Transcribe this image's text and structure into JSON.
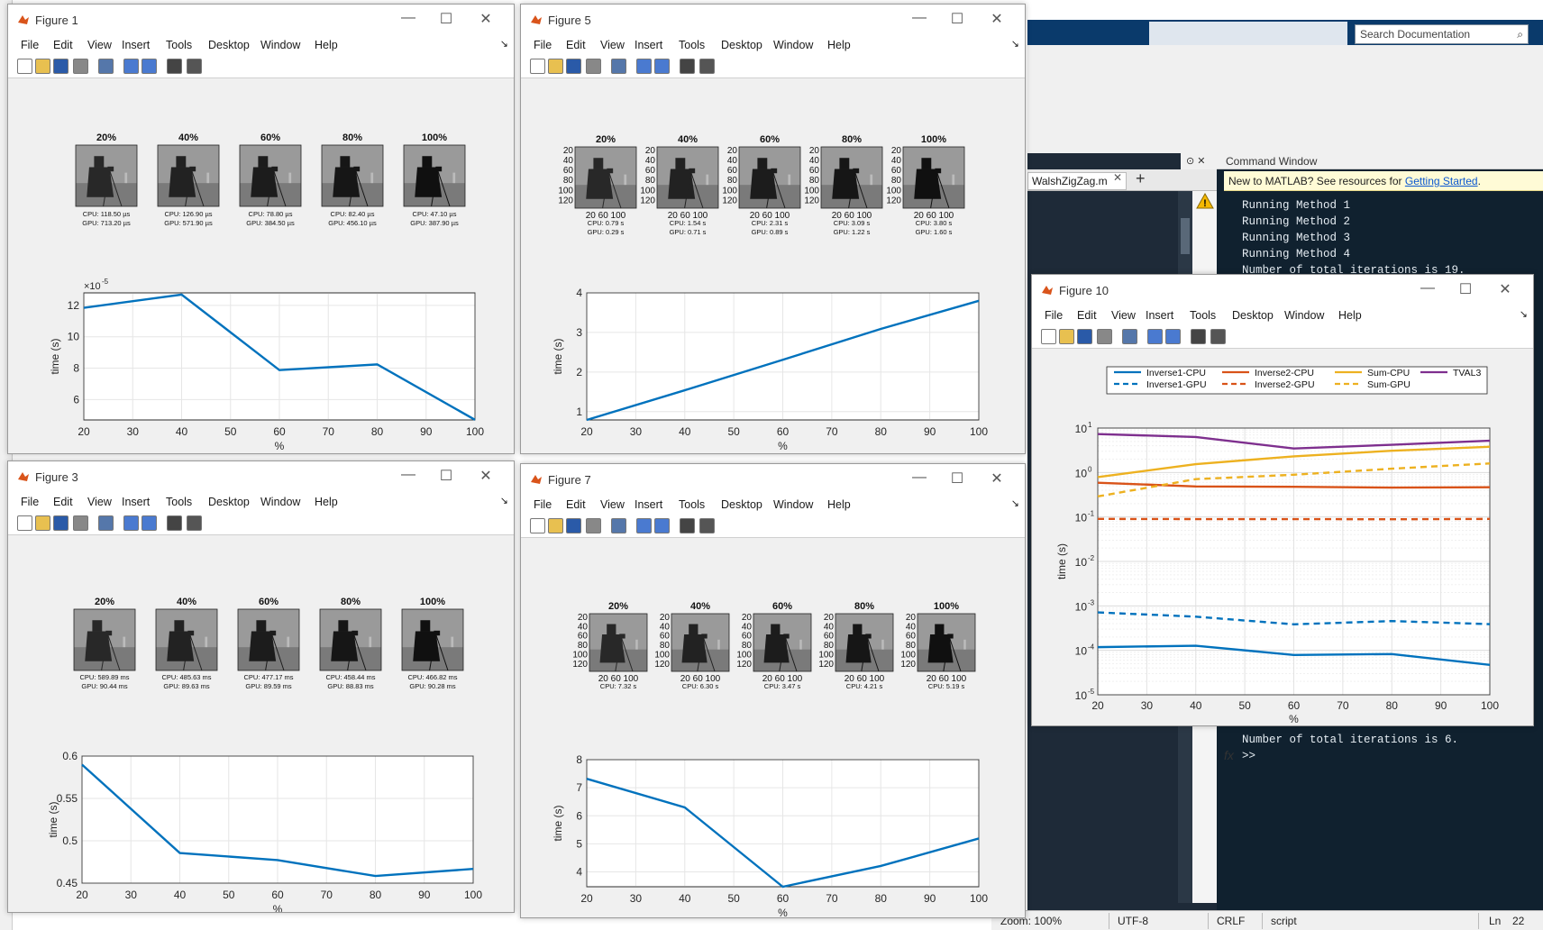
{
  "desktop": {
    "search_placeholder": "Search Documentation",
    "editor_tab": "WalshZigZag.m",
    "command_window_title": "Command Window",
    "new_to_matlab": "New to MATLAB? See resources for ",
    "getting_started": "Getting Started",
    "cmd_lines_top": [
      "Running Method 1",
      "Running Method 2",
      "Running Method 3",
      "Running Method 4",
      "Number of total iterations is 19."
    ],
    "cmd_lines_bottom": [
      "Number of total iterations is 6.",
      ">>"
    ],
    "status": {
      "zoom": "Zoom: 100%",
      "encoding": "UTF-8",
      "eol": "CRLF",
      "mode": "script",
      "ln": "Ln",
      "ln_value": "22"
    }
  },
  "menu_items": [
    "File",
    "Edit",
    "View",
    "Insert",
    "Tools",
    "Desktop",
    "Window",
    "Help"
  ],
  "win_controls": {
    "minimize": "—",
    "maximize": "☐",
    "close": "✕"
  },
  "figures": {
    "fig1": {
      "title": "Figure 1",
      "pct": [
        "20%",
        "40%",
        "60%",
        "80%",
        "100%"
      ],
      "cap1": [
        "CPU: 118.50 µs",
        "CPU: 126.90 µs",
        "CPU: 78.80 µs",
        "CPU: 82.40 µs",
        "CPU: 47.10 µs"
      ],
      "cap2": [
        "GPU: 713.20 µs",
        "GPU: 571.90 µs",
        "GPU: 384.50 µs",
        "GPU: 456.10 µs",
        "GPU: 387.90 µs"
      ],
      "chart_data": {
        "type": "line",
        "x": [
          20,
          40,
          60,
          80,
          100
        ],
        "values": [
          11.85,
          12.69,
          7.88,
          8.24,
          4.71
        ],
        "ylabel": "time (s)",
        "xlabel": "%",
        "exponent": "×10",
        "exponent_power": "-5",
        "xlim": [
          20,
          100
        ],
        "ylim": [
          4.7,
          12.8
        ],
        "yticks": [
          6,
          8,
          10,
          12
        ],
        "xticks": [
          20,
          30,
          40,
          50,
          60,
          70,
          80,
          90,
          100
        ]
      }
    },
    "fig5": {
      "title": "Figure 5",
      "pct": [
        "20%",
        "40%",
        "60%",
        "80%",
        "100%"
      ],
      "cap1": [
        "CPU: 0.79 s",
        "CPU: 1.54 s",
        "CPU: 2.31 s",
        "CPU: 3.09 s",
        "CPU: 3.80 s"
      ],
      "cap2": [
        "GPU: 0.29 s",
        "GPU: 0.71 s",
        "GPU: 0.89 s",
        "GPU: 1.22 s",
        "GPU: 1.60 s"
      ],
      "axis_ticks": [
        "20",
        "40",
        "60",
        "80",
        "100",
        "120"
      ],
      "x_ticks": "20  60 100",
      "chart_data": {
        "type": "line",
        "x": [
          20,
          40,
          60,
          80,
          100
        ],
        "values": [
          0.79,
          1.54,
          2.31,
          3.09,
          3.8
        ],
        "ylabel": "time (s)",
        "xlabel": "%",
        "xlim": [
          20,
          100
        ],
        "ylim": [
          0.79,
          4
        ],
        "yticks": [
          1,
          2,
          3,
          4
        ],
        "xticks": [
          20,
          30,
          40,
          50,
          60,
          70,
          80,
          90,
          100
        ]
      }
    },
    "fig3": {
      "title": "Figure 3",
      "pct": [
        "20%",
        "40%",
        "60%",
        "80%",
        "100%"
      ],
      "cap1": [
        "CPU: 589.89 ms",
        "CPU: 485.63 ms",
        "CPU: 477.17 ms",
        "CPU: 458.44 ms",
        "CPU: 466.82 ms"
      ],
      "cap2": [
        "GPU: 90.44 ms",
        "GPU: 89.63 ms",
        "GPU: 89.59 ms",
        "GPU: 88.83 ms",
        "GPU: 90.28 ms"
      ],
      "chart_data": {
        "type": "line",
        "x": [
          20,
          40,
          60,
          80,
          100
        ],
        "values": [
          0.5899,
          0.4856,
          0.4772,
          0.4584,
          0.4668
        ],
        "ylabel": "time (s)",
        "xlabel": "%",
        "xlim": [
          20,
          100
        ],
        "ylim": [
          0.45,
          0.6
        ],
        "yticks": [
          0.45,
          0.5,
          0.55,
          0.6
        ],
        "ytick_labels": [
          "0.45",
          "0.5",
          "0.55",
          "0.6"
        ],
        "xticks": [
          20,
          30,
          40,
          50,
          60,
          70,
          80,
          90,
          100
        ]
      }
    },
    "fig7": {
      "title": "Figure 7",
      "pct": [
        "20%",
        "40%",
        "60%",
        "80%",
        "100%"
      ],
      "cap1": [
        "CPU: 7.32 s",
        "CPU: 6.30 s",
        "CPU: 3.47 s",
        "CPU: 4.21 s",
        "CPU: 5.19 s"
      ],
      "axis_ticks": [
        "20",
        "40",
        "60",
        "80",
        "100",
        "120"
      ],
      "x_ticks": "20  60 100",
      "chart_data": {
        "type": "line",
        "x": [
          20,
          40,
          60,
          80,
          100
        ],
        "values": [
          7.32,
          6.3,
          3.47,
          4.21,
          5.19
        ],
        "ylabel": "time (s)",
        "xlabel": "%",
        "xlim": [
          20,
          100
        ],
        "ylim": [
          3.47,
          8
        ],
        "yticks": [
          4,
          5,
          6,
          7,
          8
        ],
        "xticks": [
          20,
          30,
          40,
          50,
          60,
          70,
          80,
          90,
          100
        ]
      }
    },
    "fig10": {
      "title": "Figure 10",
      "chart_data": {
        "type": "line",
        "yscale": "log",
        "xlabel": "%",
        "ylabel": "time (s)",
        "xlim": [
          20,
          100
        ],
        "ylim": [
          1e-05,
          10
        ],
        "xticks": [
          20,
          30,
          40,
          50,
          60,
          70,
          80,
          90,
          100
        ],
        "yticks": [
          "10",
          "10",
          "10",
          "10",
          "10",
          "10",
          "10"
        ],
        "ytick_exp": [
          "1",
          "0",
          "-1",
          "-2",
          "-3",
          "-4",
          "-5"
        ],
        "x": [
          20,
          40,
          60,
          80,
          100
        ],
        "legend_position": "top",
        "series": [
          {
            "name": "Inverse1-CPU",
            "color": "#0072BD",
            "dash": false,
            "values": [
              0.000118,
              0.000127,
              7.88e-05,
              8.24e-05,
              4.71e-05
            ]
          },
          {
            "name": "Inverse1-GPU",
            "color": "#0072BD",
            "dash": true,
            "values": [
              0.000713,
              0.000572,
              0.000385,
              0.000456,
              0.000388
            ]
          },
          {
            "name": "Inverse2-CPU",
            "color": "#D95319",
            "dash": false,
            "values": [
              0.59,
              0.486,
              0.477,
              0.458,
              0.467
            ]
          },
          {
            "name": "Inverse2-GPU",
            "color": "#D95319",
            "dash": true,
            "values": [
              0.0904,
              0.0896,
              0.0896,
              0.0888,
              0.0903
            ]
          },
          {
            "name": "Sum-CPU",
            "color": "#EDB120",
            "dash": false,
            "values": [
              0.79,
              1.54,
              2.31,
              3.09,
              3.8
            ]
          },
          {
            "name": "Sum-GPU",
            "color": "#EDB120",
            "dash": true,
            "values": [
              0.29,
              0.71,
              0.89,
              1.22,
              1.6
            ]
          },
          {
            "name": "TVAL3",
            "color": "#7E2F8E",
            "dash": false,
            "values": [
              7.32,
              6.3,
              3.47,
              4.21,
              5.19
            ]
          }
        ]
      }
    }
  }
}
